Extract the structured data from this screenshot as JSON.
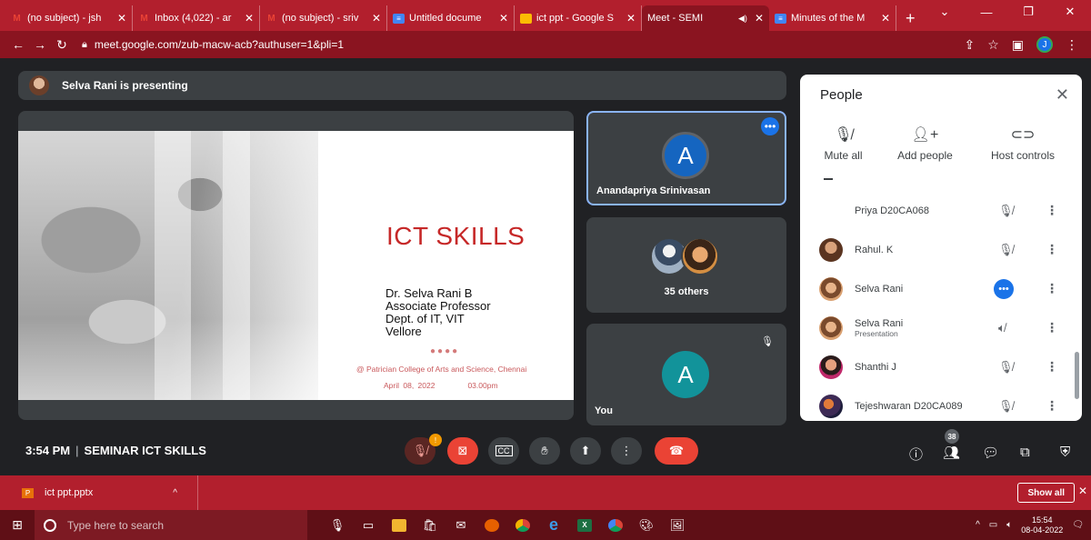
{
  "browser": {
    "tabs": [
      {
        "title": "(no subject) - jsh",
        "favicon": "gmail-icon"
      },
      {
        "title": "Inbox (4,022) - ar",
        "favicon": "gmail-icon"
      },
      {
        "title": "(no subject) - sriv",
        "favicon": "gmail-icon"
      },
      {
        "title": "Untitled docume",
        "favicon": "docs-icon"
      },
      {
        "title": "ict ppt - Google S",
        "favicon": "slides-icon"
      },
      {
        "title": "Meet - SEMI",
        "favicon": "meet-icon",
        "active": true
      },
      {
        "title": "Minutes of the M",
        "favicon": "docs-icon"
      }
    ],
    "new_tab": "+",
    "url": "meet.google.com/zub-macw-acb?authuser=1&pli=1",
    "profile_initial": "J"
  },
  "meet": {
    "presenting_banner": "Selva Rani is presenting",
    "slide": {
      "title": "ICT SKILLS",
      "author_lines": [
        "Dr. Selva Rani B",
        "Associate Professor",
        "Dept. of IT, VIT",
        "Vellore"
      ],
      "dots": "●●●●",
      "venue": "@ Patrician College of Arts and Science, Chennai",
      "date": "April 08, 2022",
      "time": "03.00pm"
    },
    "tiles": {
      "speaker": {
        "initial": "A",
        "name": "Anandapriya Srinivasan",
        "avatar_color": "#1565c0"
      },
      "others": {
        "label": "35 others"
      },
      "self": {
        "initial": "A",
        "name": "You",
        "avatar_color": "#12939a"
      }
    },
    "people_panel": {
      "title": "People",
      "actions": [
        {
          "label": "Mute all",
          "icon": "mic-off-icon"
        },
        {
          "label": "Add people",
          "icon": "add-person-icon"
        },
        {
          "label": "Host controls",
          "icon": "toggle-icon"
        }
      ],
      "participants": [
        {
          "name": "Priya D20CA068",
          "sub": "",
          "mic": "mic-off",
          "avatar": "none"
        },
        {
          "name": "Rahul. K",
          "sub": "",
          "mic": "mic-off",
          "avatar": "#8d5a3b"
        },
        {
          "name": "Selva Rani",
          "sub": "",
          "mic": "more",
          "avatar": "#c98a5e"
        },
        {
          "name": "Selva Rani",
          "sub": "Presentation",
          "mic": "presenting",
          "avatar": "#c98a5e"
        },
        {
          "name": "Shanthi J",
          "sub": "",
          "mic": "mic-off",
          "avatar": "#b0356b"
        },
        {
          "name": "Tejeshwaran D20CA089",
          "sub": "",
          "mic": "mic-off",
          "avatar": "#3c2a4a"
        }
      ]
    },
    "bottom": {
      "time": "3:54 PM",
      "separator": "|",
      "meeting_title": "SEMINAR ICT SKILLS",
      "mic_badge": "!",
      "participant_count": "38"
    }
  },
  "downloads": {
    "file_name": "ict ppt.pptx",
    "show_all": "Show all"
  },
  "taskbar": {
    "search_placeholder": "Type here to search",
    "time": "15:54",
    "date": "08-04-2022"
  }
}
